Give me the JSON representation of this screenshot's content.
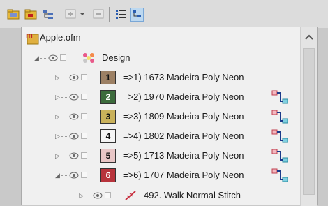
{
  "toolbar": {
    "icons": [
      "open-folder-icon",
      "folder-icon",
      "tree-view-icon",
      "add-icon",
      "dropdown-arrow-icon",
      "remove-icon",
      "list-icon",
      "properties-icon"
    ]
  },
  "tree": {
    "root": {
      "label": "Apple.ofm",
      "icon": "ofm-file-icon"
    },
    "design": {
      "label": "Design",
      "icon": "design-icon"
    },
    "colors": [
      {
        "num": "1",
        "label": "=>1) 1673 Madeira Poly Neon",
        "color": "#9c8064",
        "text_color": "#111111"
      },
      {
        "num": "2",
        "label": "=>2) 1970 Madeira Poly Neon",
        "color": "#3c6b3c",
        "text_color": "#ffffff"
      },
      {
        "num": "3",
        "label": "=>3) 1809 Madeira Poly Neon",
        "color": "#c9b15a",
        "text_color": "#111111"
      },
      {
        "num": "4",
        "label": "=>4) 1802 Madeira Poly Neon",
        "color": "#f4f4f4",
        "text_color": "#111111"
      },
      {
        "num": "5",
        "label": "=>5) 1713 Madeira Poly Neon",
        "color": "#e8c6c6",
        "text_color": "#111111"
      },
      {
        "num": "6",
        "label": "=>6) 1707 Madeira Poly Neon",
        "color": "#b8343c",
        "text_color": "#ffffff"
      }
    ],
    "stitch": {
      "label": "492. Walk Normal Stitch",
      "icon": "walk-stitch-icon"
    }
  },
  "scrollbar": {
    "up_icon": "chevron-up-icon"
  }
}
